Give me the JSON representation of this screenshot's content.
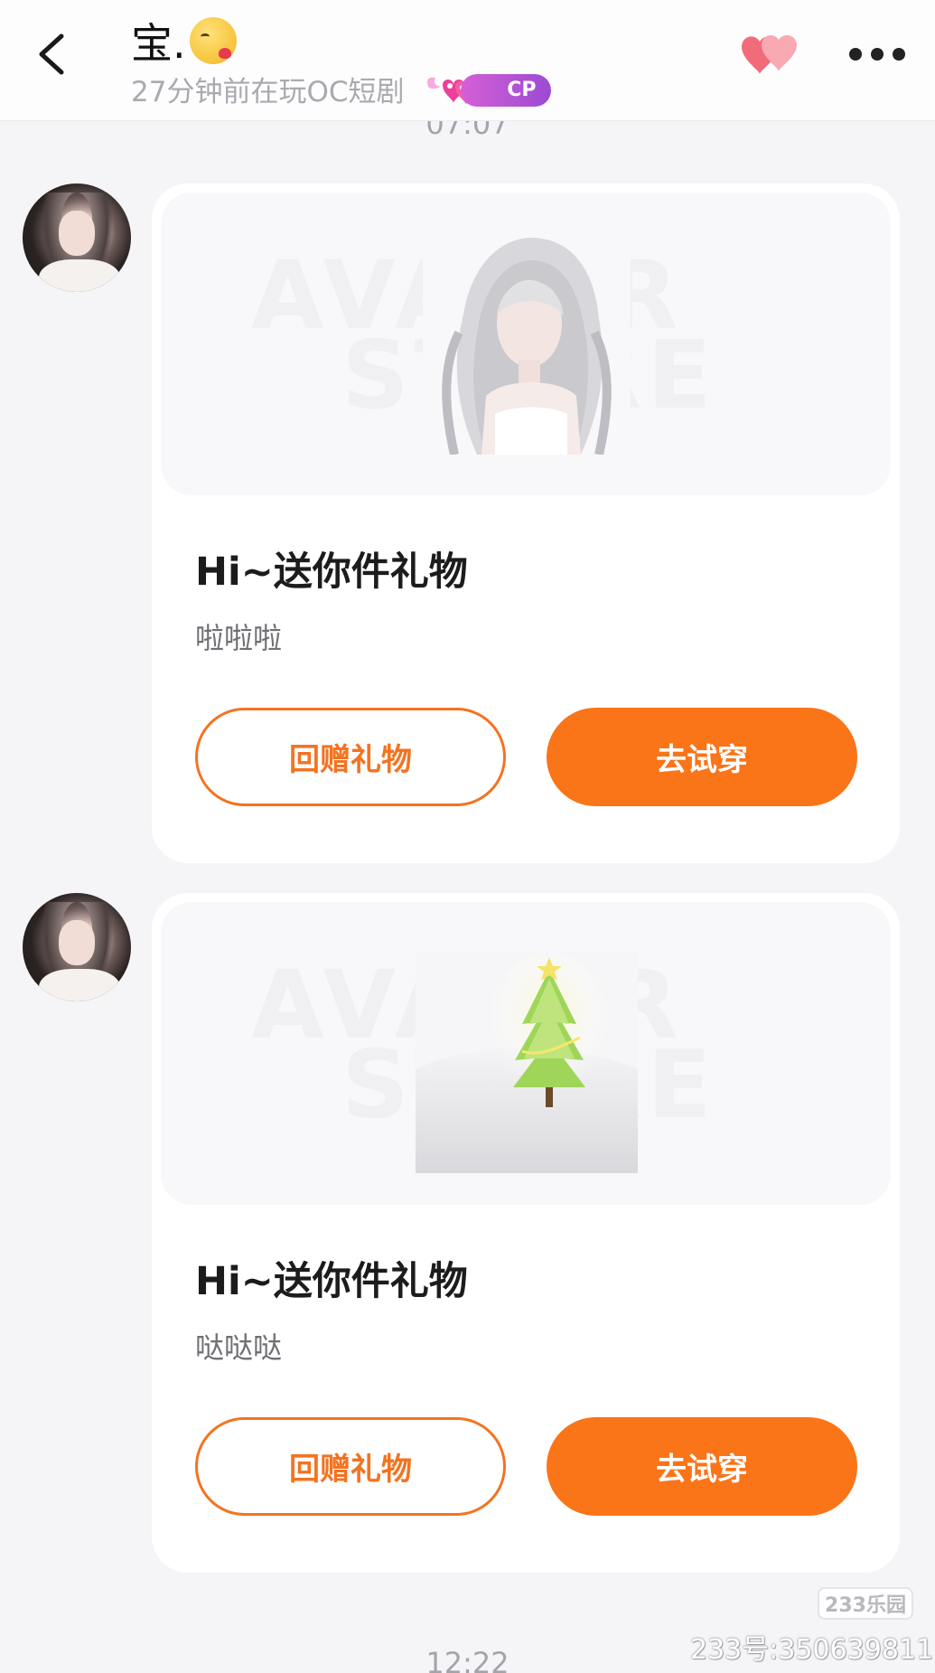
{
  "header": {
    "back_label": "back",
    "name": "宝.",
    "name_emoji": "kissing-face-emoji",
    "status": "27分钟前在玩OC短剧",
    "cp_badge": "CP"
  },
  "timestamps": {
    "top": "07:07",
    "bottom": "12:22"
  },
  "messages": [
    {
      "preview_watermark_line1": "AVATAR",
      "preview_watermark_line2": "STORE",
      "preview_item": "white-hair-outfit",
      "title": "Hi~送你件礼物",
      "message": "啦啦啦",
      "return_gift_label": "回赠礼物",
      "try_on_label": "去试穿"
    },
    {
      "preview_watermark_line1": "AVATAR",
      "preview_watermark_line2": "STORE",
      "preview_item": "christmas-tree-scene",
      "title": "Hi~送你件礼物",
      "message": "哒哒哒",
      "return_gift_label": "回赠礼物",
      "try_on_label": "去试穿"
    }
  ],
  "footer": {
    "brand_logo": "233乐园",
    "brand_id": "233号:350639811"
  },
  "colors": {
    "accent": "#fa7418",
    "background": "#f5f5f8",
    "cp_gradient_start": "#d65fd6",
    "cp_gradient_end": "#9b4bd3"
  }
}
